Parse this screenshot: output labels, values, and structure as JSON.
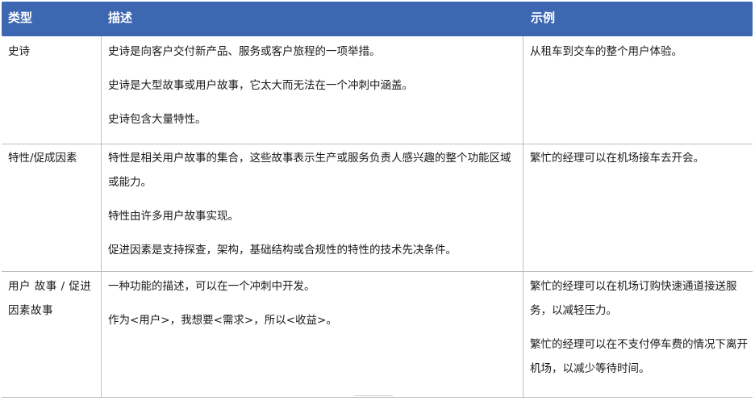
{
  "headers": {
    "type": "类型",
    "description": "描述",
    "example": "示例"
  },
  "rows": [
    {
      "type": "史诗",
      "description": [
        "史诗是向客户交付新产品、服务或客户旅程的一项举措。",
        "史诗是大型故事或用户故事，它太大而无法在一个冲刺中涵盖。",
        "史诗包含大量特性。"
      ],
      "example": [
        "从租车到交车的整个用户体验。"
      ]
    },
    {
      "type": "特性/促成因素",
      "description": [
        "特性是相关用户故事的集合，这些故事表示生产或服务负责人感兴趣的整个功能区域或能力。",
        "特性由许多用户故事实现。",
        "促进因素是支持探查，架构，基础结构或合规性的特性的技术先决条件。"
      ],
      "example": [
        "繁忙的经理可以在机场接车去开会。"
      ]
    },
    {
      "type": "用户 故事 / 促进因素故事",
      "description": [
        "一种功能的描述，可以在一个冲刺中开发。",
        "作为<用户>，我想要<需求>，所以<收益>。"
      ],
      "example": [
        "繁忙的经理可以在机场订购快速通道接送服务，以减轻压力。",
        "繁忙的经理可以在不支付停车费的情况下离开机场，以减少等待时间。"
      ]
    }
  ]
}
